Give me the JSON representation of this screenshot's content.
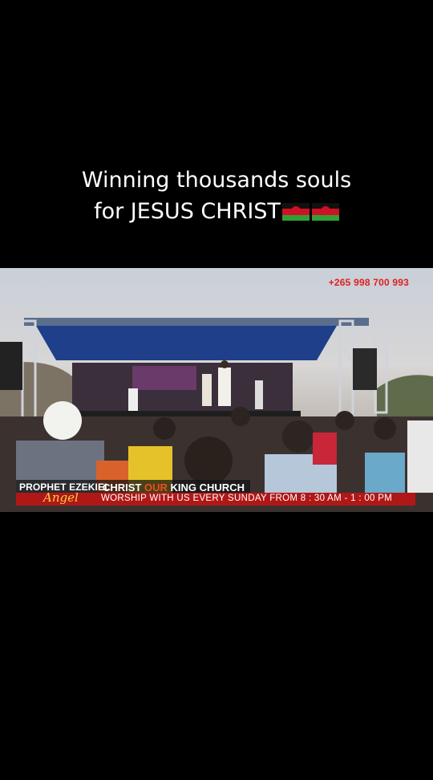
{
  "caption": {
    "line1": "Winning thousands souls",
    "line2": "for JESUS CHRIST"
  },
  "flags": [
    "malawi-flag",
    "malawi-flag"
  ],
  "video": {
    "phone": "+265 998 700 993",
    "banner": {
      "prophet": "PROPHET EZEKIEL",
      "angel": "Angel",
      "church_part1": "CHRIST",
      "church_part2": "OUR",
      "church_part3": "KING CHURCH",
      "worship": "WORSHIP WITH US EVERY SUNDAY  FROM 8 : 30 AM - 1 : 00 PM"
    }
  },
  "colors": {
    "background": "#000000",
    "banner_red": "#b01717",
    "angel_gold": "#f2d33b",
    "phone_red": "#e01f1f"
  }
}
